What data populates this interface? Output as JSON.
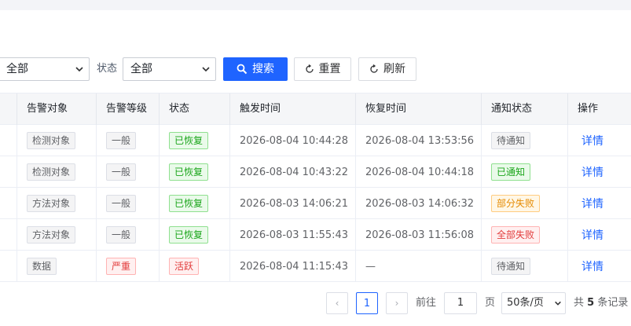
{
  "filters": {
    "first_select_value": "全部",
    "status_label": "状态",
    "status_select_value": "全部",
    "search_button": "搜索",
    "reset_button": "重置",
    "refresh_button": "刷新"
  },
  "table": {
    "columns": [
      "告警对象",
      "告警等级",
      "状态",
      "触发时间",
      "恢复时间",
      "通知状态",
      "操作"
    ],
    "rows": [
      {
        "object": "检测对象",
        "level": "一般",
        "status": "已恢复",
        "trigger_time": "2026-08-04 10:44:28",
        "recover_time": "2026-08-04 13:53:56",
        "notify": "待通知",
        "action": "详情"
      },
      {
        "object": "检测对象",
        "level": "一般",
        "status": "已恢复",
        "trigger_time": "2026-08-04 10:43:22",
        "recover_time": "2026-08-04 10:44:18",
        "notify": "已通知",
        "action": "详情"
      },
      {
        "object": "方法对象",
        "level": "一般",
        "status": "已恢复",
        "trigger_time": "2026-08-03 14:06:21",
        "recover_time": "2026-08-03 14:06:32",
        "notify": "部分失败",
        "action": "详情"
      },
      {
        "object": "方法对象",
        "level": "一般",
        "status": "已恢复",
        "trigger_time": "2026-08-03 11:55:43",
        "recover_time": "2026-08-03 11:56:08",
        "notify": "全部失败",
        "action": "详情"
      },
      {
        "object": "数据",
        "level": "严重",
        "status": "活跃",
        "trigger_time": "2026-08-04 11:15:43",
        "recover_time": "—",
        "notify": "待通知",
        "action": "详情"
      }
    ]
  },
  "pagination": {
    "prev": "‹",
    "current_page": "1",
    "next": "›",
    "goto_label": "前往",
    "goto_value": "1",
    "page_unit": "页",
    "page_size": "50条/页",
    "total_prefix": "共",
    "total_count": "5",
    "total_suffix": "条记录"
  },
  "colors": {
    "primary": "#1f64ff",
    "success": "#1aa51a",
    "danger": "#e23b3b",
    "warning": "#e58a00"
  }
}
